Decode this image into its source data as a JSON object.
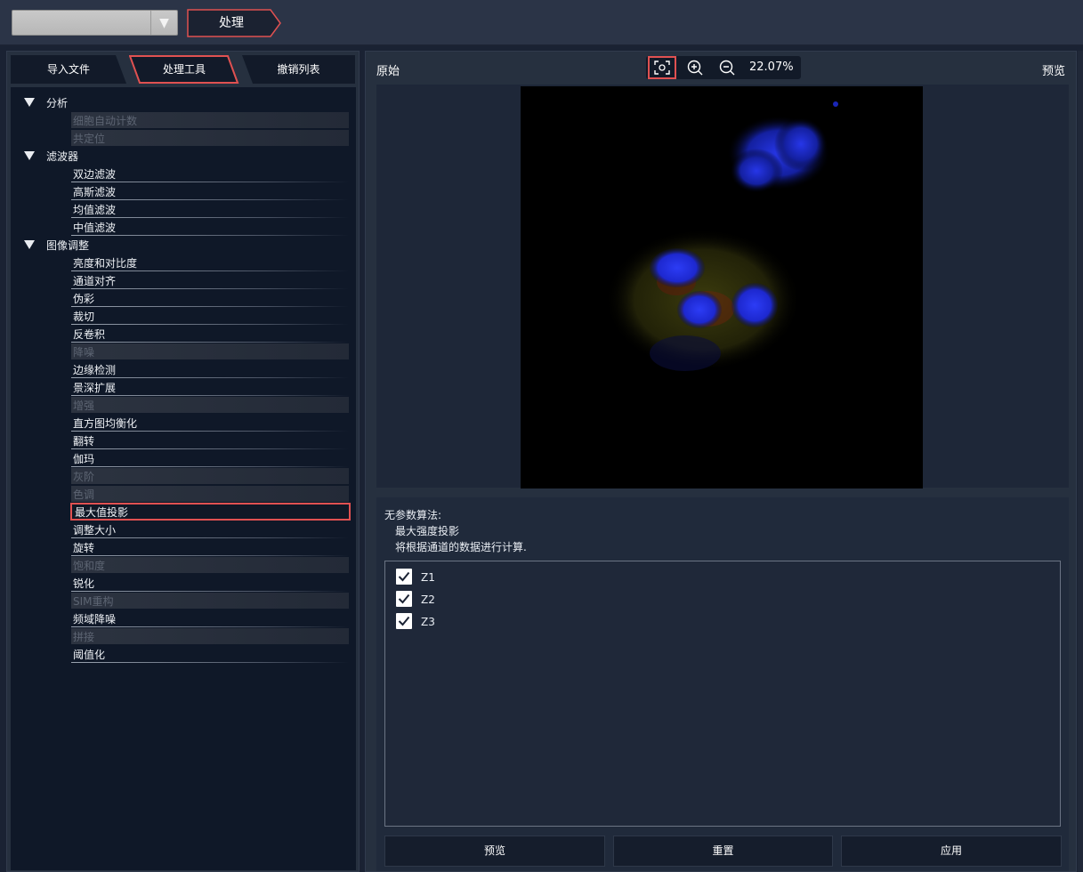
{
  "combo": {
    "value": ""
  },
  "breadcrumb": {
    "label": "处理"
  },
  "left_tabs": [
    "导入文件",
    "处理工具",
    "撤销列表"
  ],
  "tree": [
    {
      "type": "cat",
      "label": "分析"
    },
    {
      "type": "item",
      "label": "细胞自动计数",
      "disabled": true
    },
    {
      "type": "item",
      "label": "共定位",
      "disabled": true
    },
    {
      "type": "cat",
      "label": "滤波器"
    },
    {
      "type": "item",
      "label": "双边滤波"
    },
    {
      "type": "item",
      "label": "高斯滤波"
    },
    {
      "type": "item",
      "label": "均值滤波"
    },
    {
      "type": "item",
      "label": "中值滤波"
    },
    {
      "type": "cat",
      "label": "图像调整"
    },
    {
      "type": "item",
      "label": "亮度和对比度"
    },
    {
      "type": "item",
      "label": "通道对齐"
    },
    {
      "type": "item",
      "label": "伪彩"
    },
    {
      "type": "item",
      "label": "裁切"
    },
    {
      "type": "item",
      "label": "反卷积"
    },
    {
      "type": "item",
      "label": "降噪",
      "disabled": true
    },
    {
      "type": "item",
      "label": "边缘检测"
    },
    {
      "type": "item",
      "label": "景深扩展"
    },
    {
      "type": "item",
      "label": "增强",
      "disabled": true
    },
    {
      "type": "item",
      "label": "直方图均衡化"
    },
    {
      "type": "item",
      "label": "翻转"
    },
    {
      "type": "item",
      "label": "伽玛"
    },
    {
      "type": "item",
      "label": "灰阶",
      "disabled": true
    },
    {
      "type": "item",
      "label": "色调",
      "disabled": true
    },
    {
      "type": "item",
      "label": "最大值投影",
      "selected": true
    },
    {
      "type": "item",
      "label": "调整大小"
    },
    {
      "type": "item",
      "label": "旋转"
    },
    {
      "type": "item",
      "label": "饱和度",
      "disabled": true
    },
    {
      "type": "item",
      "label": "锐化"
    },
    {
      "type": "item",
      "label": "SIM重构",
      "disabled": true
    },
    {
      "type": "item",
      "label": "频域降噪"
    },
    {
      "type": "item",
      "label": "拼接",
      "disabled": true
    },
    {
      "type": "item",
      "label": "阈值化"
    }
  ],
  "viewer": {
    "original_label": "原始",
    "preview_label": "预览",
    "zoom": "22.07%"
  },
  "info": {
    "title": "无参数算法:",
    "algorithm": "最大强度投影",
    "description": "将根据通道的数据进行计算."
  },
  "channels": [
    {
      "label": "Z1",
      "checked": true
    },
    {
      "label": "Z2",
      "checked": true
    },
    {
      "label": "Z3",
      "checked": true
    }
  ],
  "buttons": {
    "preview": "预览",
    "reset": "重置",
    "apply": "应用"
  },
  "colors": {
    "accent_red": "#e05151",
    "panel": "#26303f",
    "tree_bg": "#0f1828",
    "nucleus_blue": "#2233ee"
  }
}
